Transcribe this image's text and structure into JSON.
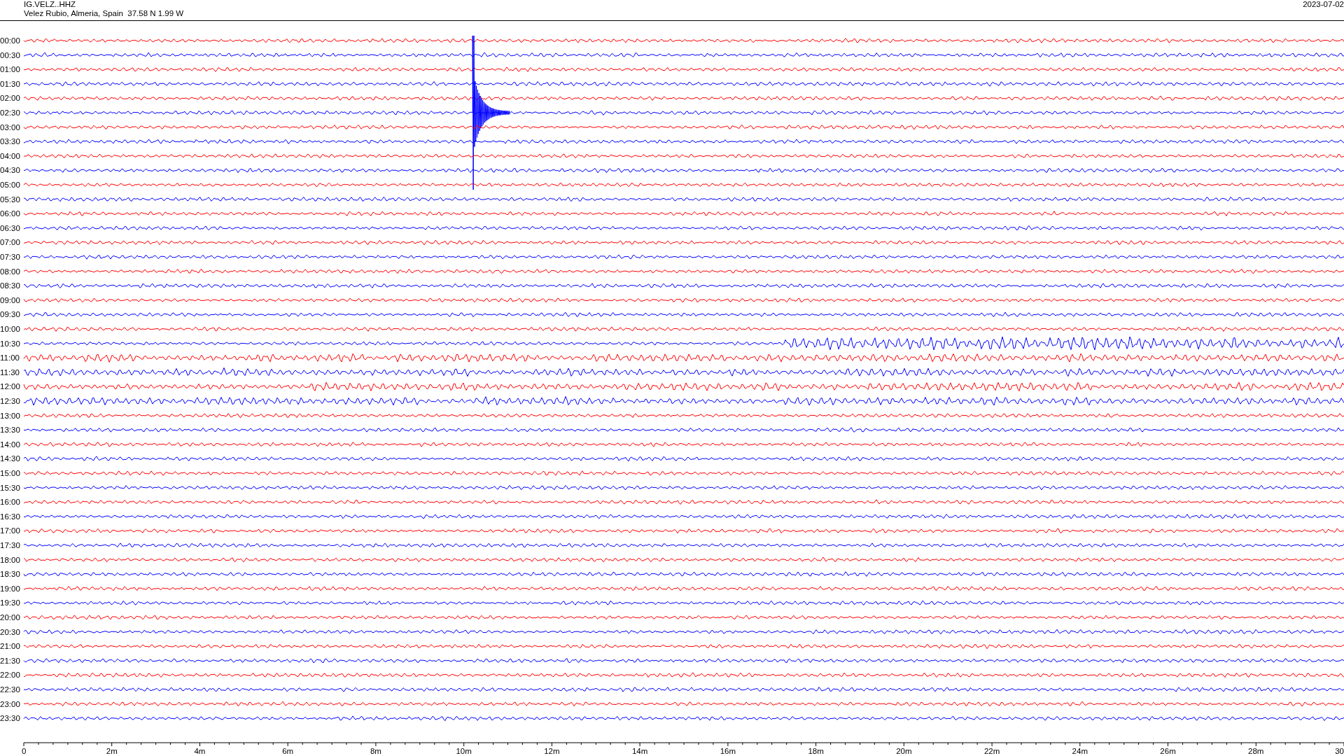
{
  "header": {
    "station": "IG.VELZ..HHZ",
    "location": "Velez Rubio, Almeria, Spain  37.58 N 1.99 W",
    "date": "2023-07-02"
  },
  "rows": [
    {
      "time": "00:00",
      "color": "#ff0000",
      "kind": "quiet"
    },
    {
      "time": "00:30",
      "color": "#0000ff",
      "kind": "quiet"
    },
    {
      "time": "01:00",
      "color": "#ff0000",
      "kind": "quiet"
    },
    {
      "time": "01:30",
      "color": "#0000ff",
      "kind": "quiet"
    },
    {
      "time": "02:00",
      "color": "#ff0000",
      "kind": "quiet"
    },
    {
      "time": "02:30",
      "color": "#0000ff",
      "kind": "quake"
    },
    {
      "time": "03:00",
      "color": "#ff0000",
      "kind": "quiet"
    },
    {
      "time": "03:30",
      "color": "#0000ff",
      "kind": "quiet"
    },
    {
      "time": "04:00",
      "color": "#ff0000",
      "kind": "quiet"
    },
    {
      "time": "04:30",
      "color": "#0000ff",
      "kind": "quiet"
    },
    {
      "time": "05:00",
      "color": "#ff0000",
      "kind": "quiet"
    },
    {
      "time": "05:30",
      "color": "#0000ff",
      "kind": "quiet"
    },
    {
      "time": "06:00",
      "color": "#ff0000",
      "kind": "quiet"
    },
    {
      "time": "06:30",
      "color": "#0000ff",
      "kind": "quiet"
    },
    {
      "time": "07:00",
      "color": "#ff0000",
      "kind": "quiet"
    },
    {
      "time": "07:30",
      "color": "#0000ff",
      "kind": "quiet"
    },
    {
      "time": "08:00",
      "color": "#ff0000",
      "kind": "quiet"
    },
    {
      "time": "08:30",
      "color": "#0000ff",
      "kind": "quiet"
    },
    {
      "time": "09:00",
      "color": "#ff0000",
      "kind": "quiet"
    },
    {
      "time": "09:30",
      "color": "#0000ff",
      "kind": "quiet"
    },
    {
      "time": "10:00",
      "color": "#ff0000",
      "kind": "quiet"
    },
    {
      "time": "10:30",
      "color": "#0000ff",
      "kind": "surface-waves"
    },
    {
      "time": "11:00",
      "color": "#ff0000",
      "kind": "noisy"
    },
    {
      "time": "11:30",
      "color": "#0000ff",
      "kind": "noisy"
    },
    {
      "time": "12:00",
      "color": "#ff0000",
      "kind": "noisy"
    },
    {
      "time": "12:30",
      "color": "#0000ff",
      "kind": "noisy"
    },
    {
      "time": "13:00",
      "color": "#ff0000",
      "kind": "quiet"
    },
    {
      "time": "13:30",
      "color": "#0000ff",
      "kind": "quiet"
    },
    {
      "time": "14:00",
      "color": "#ff0000",
      "kind": "quiet"
    },
    {
      "time": "14:30",
      "color": "#0000ff",
      "kind": "quiet"
    },
    {
      "time": "15:00",
      "color": "#ff0000",
      "kind": "quiet"
    },
    {
      "time": "15:30",
      "color": "#0000ff",
      "kind": "quiet"
    },
    {
      "time": "16:00",
      "color": "#ff0000",
      "kind": "quiet"
    },
    {
      "time": "16:30",
      "color": "#0000ff",
      "kind": "quiet"
    },
    {
      "time": "17:00",
      "color": "#ff0000",
      "kind": "quiet"
    },
    {
      "time": "17:30",
      "color": "#0000ff",
      "kind": "quiet"
    },
    {
      "time": "18:00",
      "color": "#ff0000",
      "kind": "quiet"
    },
    {
      "time": "18:30",
      "color": "#0000ff",
      "kind": "quiet"
    },
    {
      "time": "19:00",
      "color": "#ff0000",
      "kind": "quiet"
    },
    {
      "time": "19:30",
      "color": "#0000ff",
      "kind": "quiet"
    },
    {
      "time": "20:00",
      "color": "#ff0000",
      "kind": "quiet"
    },
    {
      "time": "20:30",
      "color": "#0000ff",
      "kind": "quiet"
    },
    {
      "time": "21:00",
      "color": "#ff0000",
      "kind": "quiet"
    },
    {
      "time": "21:30",
      "color": "#0000ff",
      "kind": "quiet"
    },
    {
      "time": "22:00",
      "color": "#ff0000",
      "kind": "quiet"
    },
    {
      "time": "22:30",
      "color": "#0000ff",
      "kind": "quiet"
    },
    {
      "time": "23:00",
      "color": "#ff0000",
      "kind": "quiet"
    },
    {
      "time": "23:30",
      "color": "#0000ff",
      "kind": "quiet"
    }
  ],
  "time_axis": {
    "ticks": [
      "0",
      "2m",
      "4m",
      "6m",
      "8m",
      "10m",
      "12m",
      "14m",
      "16m",
      "18m",
      "20m",
      "22m",
      "24m",
      "26m",
      "28m",
      "30"
    ]
  }
}
